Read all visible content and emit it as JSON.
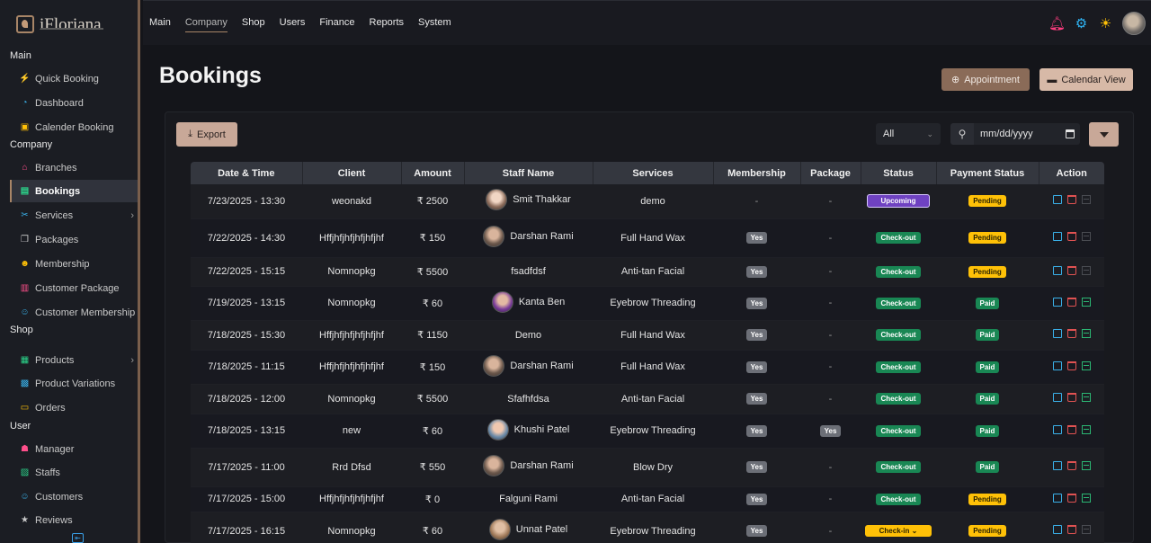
{
  "app": {
    "logo": "iFloriana"
  },
  "topnav": {
    "items": [
      "Main",
      "Company",
      "Shop",
      "Users",
      "Finance",
      "Reports",
      "System"
    ],
    "active": "Company"
  },
  "sidebar": {
    "sections": [
      {
        "title": "Main",
        "items": [
          {
            "label": "Quick Booking",
            "icon": "bolt-icon"
          },
          {
            "label": "Dashboard",
            "icon": "gauge-icon"
          },
          {
            "label": "Calender Booking",
            "icon": "calendar-icon"
          }
        ]
      },
      {
        "title": "Company",
        "items": [
          {
            "label": "Branches",
            "icon": "home-icon"
          },
          {
            "label": "Bookings",
            "icon": "table-icon",
            "active": true
          },
          {
            "label": "Services",
            "icon": "scissors-icon",
            "has_children": true
          },
          {
            "label": "Packages",
            "icon": "box-icon"
          },
          {
            "label": "Membership",
            "icon": "users-icon"
          },
          {
            "label": "Customer Package",
            "icon": "card-icon"
          },
          {
            "label": "Customer Membership",
            "icon": "user-badge-icon"
          }
        ]
      },
      {
        "title": "Shop",
        "items": [
          {
            "label": "Products",
            "icon": "stack-icon",
            "has_children": true
          },
          {
            "label": "Product Variations",
            "icon": "variation-icon"
          },
          {
            "label": "Orders",
            "icon": "bag-icon"
          }
        ]
      },
      {
        "title": "User",
        "items": [
          {
            "label": "Manager",
            "icon": "manager-icon"
          },
          {
            "label": "Staffs",
            "icon": "staff-icon"
          },
          {
            "label": "Customers",
            "icon": "customer-icon"
          },
          {
            "label": "Reviews",
            "icon": "star-icon"
          }
        ]
      }
    ]
  },
  "page": {
    "title": "Bookings",
    "appointment_btn": "Appointment",
    "calendar_btn": "Calendar View",
    "export_btn": "Export",
    "filter_select": "All",
    "date_placeholder": "mm/dd/yyyy"
  },
  "table": {
    "columns": [
      "Date & Time",
      "Client",
      "Amount",
      "Staff Name",
      "Services",
      "Membership",
      "Package",
      "Status",
      "Payment Status",
      "Action"
    ],
    "rows": [
      {
        "date": "7/23/2025 - 13:30",
        "client": "weonakd",
        "amount": "₹ 2500",
        "staff": "Smit Thakkar",
        "avatar": true,
        "service": "demo",
        "membership": "-",
        "package": "-",
        "status": "Upcoming",
        "status_type": "purple",
        "payment": "Pending",
        "payment_type": "yellow",
        "inv_dark": true
      },
      {
        "date": "7/22/2025 - 14:30",
        "client": "Hffjhfjhfjhfjhfjhf",
        "amount": "₹ 150",
        "staff": "Darshan Rami",
        "avatar": true,
        "service": "Full Hand Wax",
        "membership": "Yes",
        "package": "-",
        "status": "Check-out",
        "status_type": "green",
        "payment": "Pending",
        "payment_type": "yellow",
        "inv_dark": true
      },
      {
        "date": "7/22/2025 - 15:15",
        "client": "Nomnopkg",
        "amount": "₹ 5500",
        "staff": "fsadfdsf",
        "avatar": false,
        "service": "Anti-tan Facial",
        "membership": "Yes",
        "package": "-",
        "status": "Check-out",
        "status_type": "green",
        "payment": "Pending",
        "payment_type": "yellow",
        "inv_dark": true
      },
      {
        "date": "7/19/2025 - 13:15",
        "client": "Nomnopkg",
        "amount": "₹ 60",
        "staff": "Kanta Ben",
        "avatar": true,
        "service": "Eyebrow Threading",
        "membership": "Yes",
        "package": "-",
        "status": "Check-out",
        "status_type": "green",
        "payment": "Paid",
        "payment_type": "green",
        "inv_dark": false
      },
      {
        "date": "7/18/2025 - 15:30",
        "client": "Hffjhfjhfjhfjhfjhf",
        "amount": "₹ 1150",
        "staff": "Demo",
        "avatar": false,
        "service": "Full Hand Wax",
        "membership": "Yes",
        "package": "-",
        "status": "Check-out",
        "status_type": "green",
        "payment": "Paid",
        "payment_type": "green",
        "inv_dark": false
      },
      {
        "date": "7/18/2025 - 11:15",
        "client": "Hffjhfjhfjhfjhfjhf",
        "amount": "₹ 150",
        "staff": "Darshan Rami",
        "avatar": true,
        "service": "Full Hand Wax",
        "membership": "Yes",
        "package": "-",
        "status": "Check-out",
        "status_type": "green",
        "payment": "Paid",
        "payment_type": "green",
        "inv_dark": false
      },
      {
        "date": "7/18/2025 - 12:00",
        "client": "Nomnopkg",
        "amount": "₹ 5500",
        "staff": "Sfafhfdsa",
        "avatar": false,
        "service": "Anti-tan Facial",
        "membership": "Yes",
        "package": "-",
        "status": "Check-out",
        "status_type": "green",
        "payment": "Paid",
        "payment_type": "green",
        "inv_dark": false
      },
      {
        "date": "7/18/2025 - 13:15",
        "client": "new",
        "amount": "₹ 60",
        "staff": "Khushi Patel",
        "avatar": true,
        "service": "Eyebrow Threading",
        "membership": "Yes",
        "package": "Yes",
        "status": "Check-out",
        "status_type": "green",
        "payment": "Paid",
        "payment_type": "green",
        "inv_dark": false
      },
      {
        "date": "7/17/2025 - 11:00",
        "client": "Rrd Dfsd",
        "amount": "₹ 550",
        "staff": "Darshan Rami",
        "avatar": true,
        "service": "Blow Dry",
        "membership": "Yes",
        "package": "-",
        "status": "Check-out",
        "status_type": "green",
        "payment": "Paid",
        "payment_type": "green",
        "inv_dark": false
      },
      {
        "date": "7/17/2025 - 15:00",
        "client": "Hffjhfjhfjhfjhfjhf",
        "amount": "₹ 0",
        "staff": "Falguni Rami",
        "avatar": false,
        "service": "Anti-tan Facial",
        "membership": "Yes",
        "package": "-",
        "status": "Check-out",
        "status_type": "green",
        "payment": "Pending",
        "payment_type": "yellow",
        "inv_dark": false
      },
      {
        "date": "7/17/2025 - 16:15",
        "client": "Nomnopkg",
        "amount": "₹ 60",
        "staff": "Unnat Patel",
        "avatar": true,
        "service": "Eyebrow Threading",
        "membership": "Yes",
        "package": "-",
        "status": "Check-in",
        "status_type": "check",
        "payment": "Pending",
        "payment_type": "yellow",
        "inv_dark": true
      }
    ]
  },
  "colors": {
    "accent": "#a88567",
    "button_primary": "#8a6b58",
    "button_light": "#d7b9a7",
    "bell": "#ff3d7f",
    "gear": "#2fb5f5",
    "sun": "#ffc107"
  }
}
